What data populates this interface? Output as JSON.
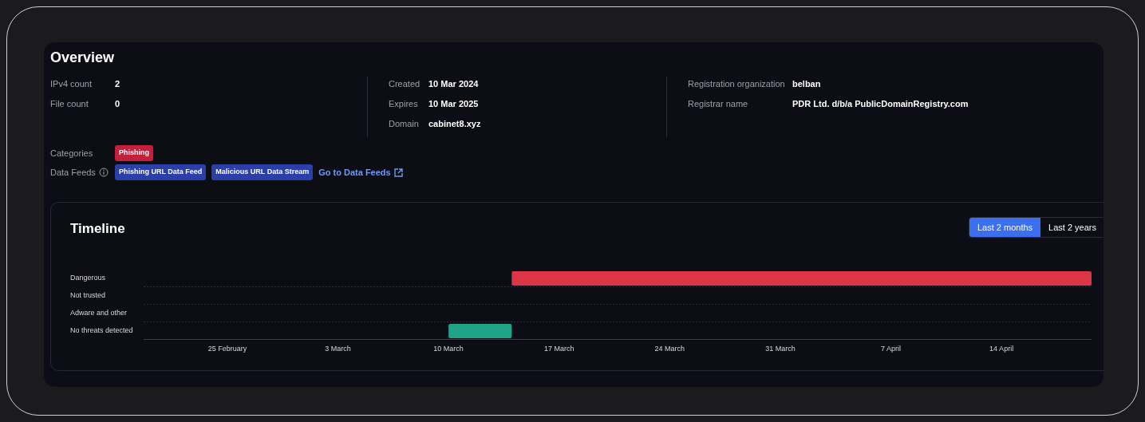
{
  "overview": {
    "title": "Overview",
    "columns": [
      {
        "fields": [
          {
            "label": "IPv4 count",
            "value": "2"
          },
          {
            "label": "File count",
            "value": "0"
          }
        ]
      },
      {
        "fields": [
          {
            "label": "Created",
            "value": "10 Mar 2024"
          },
          {
            "label": "Expires",
            "value": "10 Mar 2025"
          },
          {
            "label": "Domain",
            "value": "cabinet8.xyz"
          }
        ]
      },
      {
        "fields": [
          {
            "label": "Registration organization",
            "value": "belban"
          },
          {
            "label": "Registrar name",
            "value": "PDR Ltd. d/b/a PublicDomainRegistry.com"
          }
        ]
      }
    ],
    "categories": {
      "label": "Categories",
      "tags": [
        {
          "text": "Phishing",
          "color": "#c4203e"
        }
      ]
    },
    "data_feeds": {
      "label": "Data Feeds",
      "tags": [
        {
          "text": "Phishing URL Data Feed",
          "color": "#2b3fa8"
        },
        {
          "text": "Malicious URL Data Stream",
          "color": "#2b3fa8"
        }
      ],
      "link": "Go to Data Feeds"
    }
  },
  "timeline": {
    "title": "Timeline",
    "ranges": [
      {
        "label": "Last 2 months",
        "selected": true
      },
      {
        "label": "Last 2 years",
        "selected": false
      }
    ],
    "rows": [
      {
        "label": "Dangerous",
        "color": "#dc3545"
      },
      {
        "label": "Not trusted"
      },
      {
        "label": "Adware and other"
      },
      {
        "label": "No threats detected",
        "color": "#1fa386"
      }
    ],
    "axis_labels": [
      "25 February",
      "3 March",
      "10 March",
      "17 March",
      "24 March",
      "31 March",
      "7 April",
      "14 April"
    ]
  }
}
